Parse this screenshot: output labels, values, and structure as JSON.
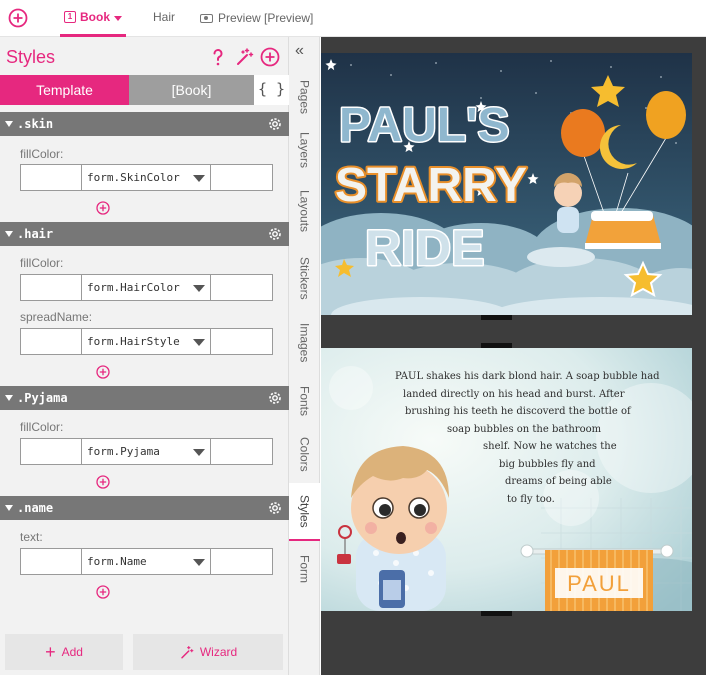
{
  "topbar": {
    "add_icon": "plus-circle-icon",
    "book_tab": {
      "number": "1",
      "label": "Book"
    },
    "hair_tab": "Hair",
    "preview_tab": "Preview [Preview]"
  },
  "panel": {
    "title": "Styles",
    "icons": [
      "question-icon",
      "magic-wand-icon",
      "plus-circle-icon"
    ],
    "segments": {
      "template": "Template",
      "book": "[Book]",
      "code": "{ }"
    },
    "sections": [
      {
        "name": ".skin",
        "fields": [
          {
            "label": "fillColor:",
            "value": "form.SkinColor"
          }
        ]
      },
      {
        "name": ".hair",
        "fields": [
          {
            "label": "fillColor:",
            "value": "form.HairColor"
          },
          {
            "label": "spreadName:",
            "value": "form.HairStyle"
          }
        ]
      },
      {
        "name": ".Pyjama",
        "fields": [
          {
            "label": "fillColor:",
            "value": "form.Pyjama"
          }
        ]
      },
      {
        "name": ".name",
        "fields": [
          {
            "label": "text:",
            "value": "form.Name"
          }
        ]
      }
    ],
    "buttons": {
      "add": "Add",
      "wizard": "Wizard"
    }
  },
  "vtabs": [
    "Pages",
    "Layers",
    "Layouts",
    "Stickers",
    "Images",
    "Fonts",
    "Colors",
    "Styles",
    "Form"
  ],
  "vtabs_active": "Styles",
  "spread1": {
    "title_lines": [
      "PAUL'S",
      "STARRY",
      "RIDE"
    ]
  },
  "spread2": {
    "story_lines": [
      "PAUL shakes his dark blond hair.  A soap bubble had",
      "landed directly on his head and burst.  After",
      "brushing his teeth he discoverd the bottle of",
      "soap bubbles on the bathroom",
      "shelf.  Now he watches the",
      "big bubbles fly and",
      "dreams of being able",
      "to fly too."
    ],
    "towel_name": "PAUL"
  },
  "colors": {
    "accent": "#e6287f",
    "section": "#777777",
    "night": "#2d4258"
  }
}
